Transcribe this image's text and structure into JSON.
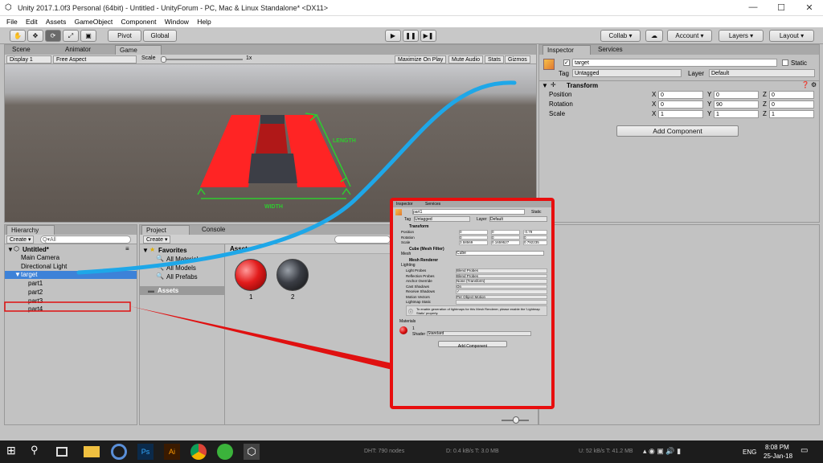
{
  "window": {
    "title": "Unity 2017.1.0f3 Personal (64bit) - Untitled - UnityForum - PC, Mac & Linux Standalone* <DX11>",
    "minimize": "—",
    "maximize": "☐",
    "close": "✕"
  },
  "menu": [
    "File",
    "Edit",
    "Assets",
    "GameObject",
    "Component",
    "Window",
    "Help"
  ],
  "toolbar": {
    "pivot": "Pivot",
    "global": "Global",
    "collab": "Collab",
    "account": "Account",
    "layers": "Layers",
    "layout": "Layout"
  },
  "scene_tabs": [
    "Scene",
    "Animator",
    "Game"
  ],
  "game_bar": {
    "display": "Display 1",
    "aspect": "Free Aspect",
    "scale_label": "Scale",
    "scale_value": "1x",
    "maximize": "Maximize On Play",
    "mute": "Mute Audio",
    "stats": "Stats",
    "gizmos": "Gizmos"
  },
  "scene_labels": {
    "length": "LENGTH",
    "width": "WIDTH"
  },
  "hierarchy": {
    "tab": "Hierarchy",
    "create": "Create",
    "search": "Q▾All",
    "scene": "Untitled*",
    "items": [
      "Main Camera",
      "Directional Light",
      "target",
      "part1",
      "part2",
      "part3",
      "part4"
    ]
  },
  "project": {
    "tabs": [
      "Project",
      "Console"
    ],
    "create": "Create",
    "favorites": "Favorites",
    "fav_items": [
      "All Materials",
      "All Models",
      "All Prefabs"
    ],
    "assets_folder": "Assets",
    "assets_header": "Assets",
    "asset_items": [
      "1",
      "2"
    ]
  },
  "inspector": {
    "tabs": [
      "Inspector",
      "Services"
    ],
    "name": "target",
    "static": "Static",
    "tag_label": "Tag",
    "tag": "Untagged",
    "layer_label": "Layer",
    "layer": "Default",
    "component": "Transform",
    "rows": [
      {
        "label": "Position",
        "x": "0",
        "y": "0",
        "z": "0"
      },
      {
        "label": "Rotation",
        "x": "0",
        "y": "90",
        "z": "0"
      },
      {
        "label": "Scale",
        "x": "1",
        "y": "1",
        "z": "1"
      }
    ],
    "add_component": "Add Component"
  },
  "mini_inspector": {
    "tabs": [
      "Inspector",
      "Services"
    ],
    "name": "part1",
    "static": "Static",
    "tag_label": "Tag",
    "tag": "Untagged",
    "layer_label": "Layer",
    "layer": "Default",
    "transform": "Transform",
    "rows": [
      {
        "label": "Position",
        "x": "0",
        "y": "0",
        "z": "-0.79"
      },
      {
        "label": "Rotation",
        "x": "0",
        "y": "0",
        "z": "0"
      },
      {
        "label": "Scale",
        "x": "3.58569",
        "y": "0.1659527",
        "z": "0.792235"
      }
    ],
    "mesh_filter": "Cube (Mesh Filter)",
    "mesh_label": "Mesh",
    "mesh": "Cube",
    "renderer": "Mesh Renderer",
    "lighting": "Lighting",
    "props": [
      {
        "label": "Light Probes",
        "value": "Blend Probes"
      },
      {
        "label": "Reflection Probes",
        "value": "Blend Probes"
      },
      {
        "label": "Anchor Override",
        "value": "None (Transform)"
      },
      {
        "label": "Cast Shadows",
        "value": "On"
      },
      {
        "label": "Receive Shadows",
        "value": "✓"
      },
      {
        "label": "Motion Vectors",
        "value": "Per Object Motion"
      },
      {
        "label": "Lightmap Static",
        "value": ""
      }
    ],
    "note": "To enable generation of lightmaps for this Mesh Renderer, please enable the 'Lightmap Static' property.",
    "materials": "Materials",
    "material_name": "1",
    "shader_label": "Shader",
    "shader": "Standard",
    "add_component": "Add Component"
  },
  "statusbar": {
    "dht": "DHT: 790 nodes",
    "net1": "D: 0.4 kB/s T: 3.0 MB",
    "net2": "U: 52 kB/s T: 41.2 MB"
  },
  "taskbar": {
    "lang": "ENG",
    "time": "8:08 PM",
    "date": "25-Jan-18"
  },
  "colors": {
    "accent_select": "#3d82d8",
    "red": "#ff2a2a",
    "cyan": "#1ea7e8",
    "green": "#2ecc2e"
  }
}
